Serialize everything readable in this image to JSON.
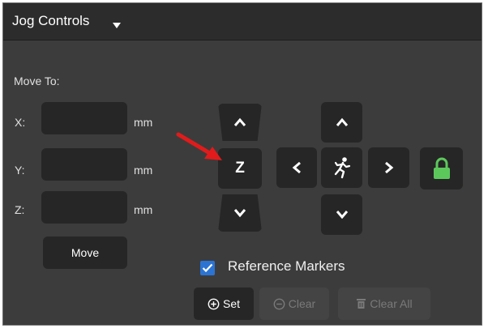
{
  "panel": {
    "title": "Jog Controls"
  },
  "move_to": {
    "heading": "Move To:",
    "fields": [
      {
        "axis": "X:",
        "value": "",
        "unit": "mm"
      },
      {
        "axis": "Y:",
        "value": "",
        "unit": "mm"
      },
      {
        "axis": "Z:",
        "value": "",
        "unit": "mm"
      }
    ],
    "move_button": "Move"
  },
  "jog": {
    "z_label": "Z",
    "lock_color": "#5cc85c"
  },
  "reference_markers": {
    "label": "Reference Markers",
    "checked": true,
    "buttons": [
      {
        "label": "Set",
        "icon": "plus-circle-icon",
        "enabled": true
      },
      {
        "label": "Clear",
        "icon": "minus-circle-icon",
        "enabled": false
      },
      {
        "label": "Clear All",
        "icon": "trash-icon",
        "enabled": false
      }
    ]
  },
  "colors": {
    "annotation_arrow": "#e11b1b",
    "checkbox": "#2c74d3"
  }
}
